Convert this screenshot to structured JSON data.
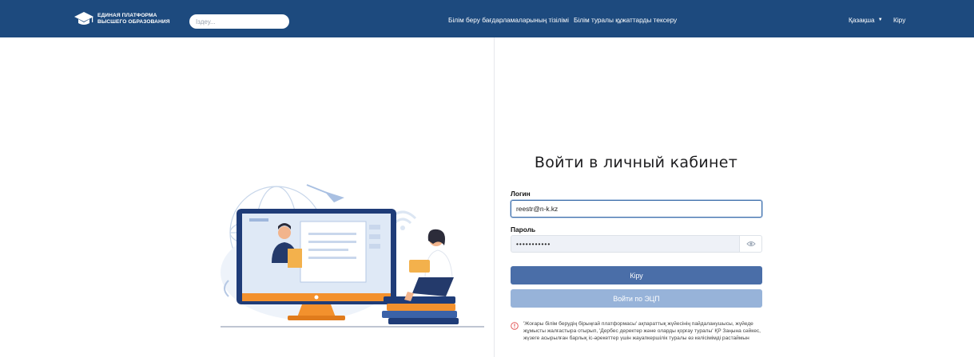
{
  "header": {
    "logo_line1": "ЕДИНАЯ ПЛАТФОРМА",
    "logo_line2": "ВЫСШЕГО ОБРАЗОВАНИЯ",
    "search_placeholder": "Іздеу...",
    "nav": [
      {
        "label": "Білім беру бағдарламаларының тізілімі"
      },
      {
        "label": "Білім туралы құжаттарды тексеру"
      }
    ],
    "language": "Қазақша",
    "login_link": "Кіру",
    "background_color": "#1d4a7e"
  },
  "form": {
    "title": "Войти в личный кабинет",
    "login_label": "Логин",
    "login_value": "reestr@n-k.kz",
    "password_label": "Пароль",
    "password_value": "•••••••••••",
    "login_button": "Кіру",
    "ecp_button": "Войти по ЭЦП",
    "notice": "'Жоғары білім берудің бірыңғай платформасы' ақпараттық жүйесінің пайдаланушысы, жүйеде жұмысты жалғастыра отырып, 'Дербес деректер және оларды қорғау туралы' ҚР Заңына сәйкес, жүзеге асырылған барлық іс-әрекеттер үшін жауапкершілік туралы өз келісімімді растаймын"
  },
  "colors": {
    "primary_button": "#4a6ea8",
    "secondary_button": "#97b3d9",
    "notice_icon": "#e04a4a"
  },
  "icons": {
    "logo": "graduation-cap-icon",
    "password_toggle": "eye-icon",
    "notice": "warning-circle-icon"
  }
}
